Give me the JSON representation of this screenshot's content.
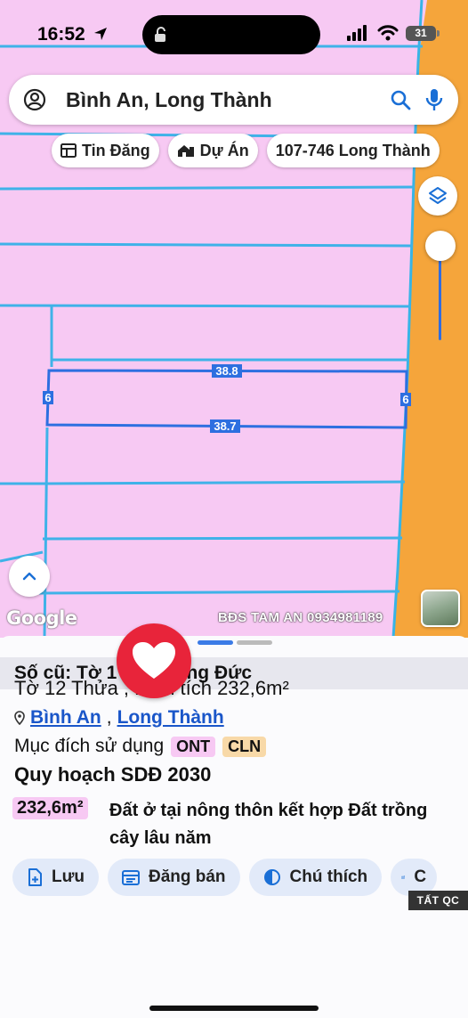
{
  "status": {
    "time": "16:52",
    "battery": "31"
  },
  "search": {
    "query": "Bình An, Long Thành"
  },
  "chips": [
    {
      "label": "Tin Đăng",
      "icon": "listing-icon"
    },
    {
      "label": "Dự Án",
      "icon": "project-icon"
    },
    {
      "label": "107-746 Long Thành",
      "icon": ""
    }
  ],
  "map": {
    "parcel": {
      "top_len": "38.8",
      "bottom_len": "38.7",
      "left_len": "6",
      "right_len": "6"
    },
    "google": "Google",
    "watermark": "BĐS TAM AN 0934981189",
    "colors": {
      "residential": "#f7c9f3",
      "road": "#f5a53b",
      "boundary": "#3fb2e8",
      "parcel": "#2d6fe0"
    }
  },
  "sheet": {
    "title": "Số cũ: Tờ 1 490, Long Đức",
    "line1": "Tờ 12 Thửa , Diện tích 232,6m²",
    "commune": "Bình An",
    "separator": ",",
    "district": "Long Thành",
    "purpose_label": "Mục đích sử dụng",
    "tags": [
      "ONT",
      "CLN"
    ],
    "plan": "Quy hoạch SDĐ 2030",
    "area": "232,6m²",
    "area_desc": "Đất ở tại nông thôn kết hợp Đất trồng cây lâu năm"
  },
  "actions": [
    {
      "label": "Lưu"
    },
    {
      "label": "Đăng bán"
    },
    {
      "label": "Chú thích"
    },
    {
      "label": "C"
    }
  ],
  "ad_label": "TẤT QC"
}
